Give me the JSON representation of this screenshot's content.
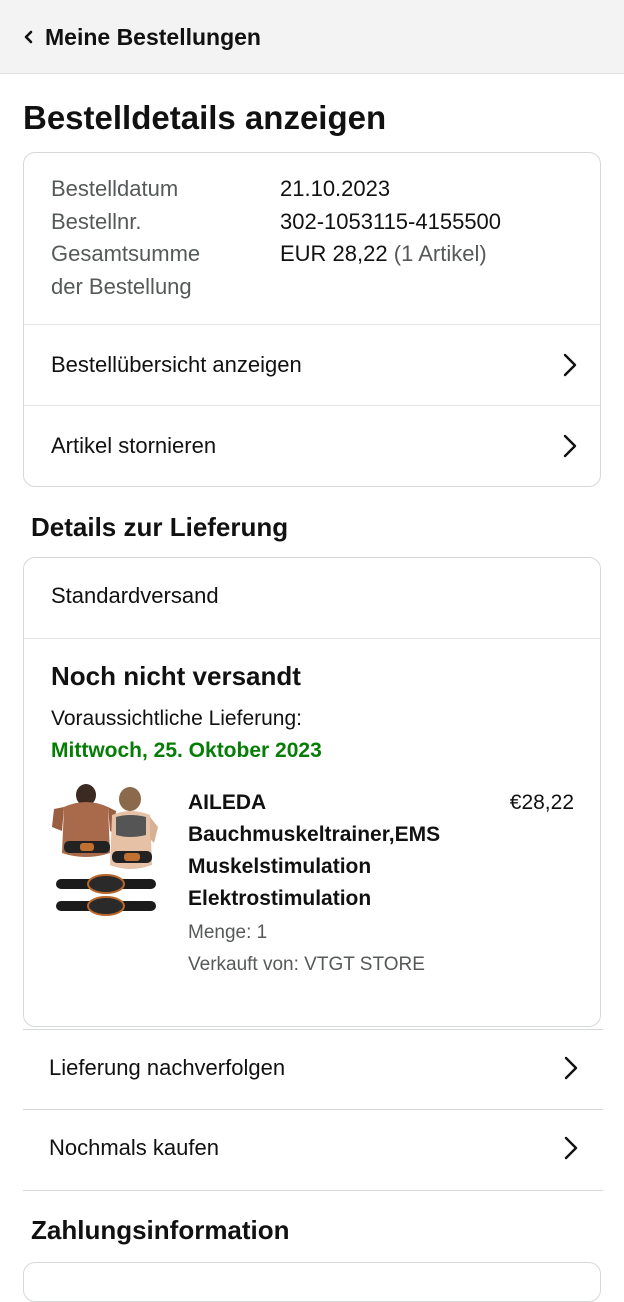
{
  "header": {
    "back_label": "Meine Bestellungen"
  },
  "page_title": "Bestelldetails anzeigen",
  "order": {
    "labels": [
      "Bestelldatum",
      "Bestellnr.",
      "Gesamtsumme",
      "der Bestellung"
    ],
    "date": "21.10.2023",
    "number": "302-1053115-4155500",
    "total": "EUR 28,22",
    "item_count": "(1 Artikel)"
  },
  "order_actions": [
    {
      "label": "Bestellübersicht anzeigen"
    },
    {
      "label": "Artikel stornieren"
    }
  ],
  "delivery_section": {
    "title": "Details zur Lieferung"
  },
  "delivery": {
    "method": "Standardversand",
    "status": "Noch nicht versandt",
    "eta_label": "Voraussichtliche Lieferung:",
    "eta_date": "Mittwoch, 25. Oktober 2023",
    "status_color": "#067d06"
  },
  "product": {
    "name_lines": [
      "AILEDA",
      "Bauchmuskeltrainer,EMS",
      "Muskelstimulation",
      "Elektrostimulation"
    ],
    "price": "€28,22",
    "quantity": "Menge: 1",
    "seller": "Verkauft von: VTGT STORE"
  },
  "delivery_actions": [
    {
      "label": "Lieferung nachverfolgen"
    },
    {
      "label": "Nochmals kaufen"
    }
  ],
  "payment_section": {
    "title": "Zahlungsinformation"
  }
}
